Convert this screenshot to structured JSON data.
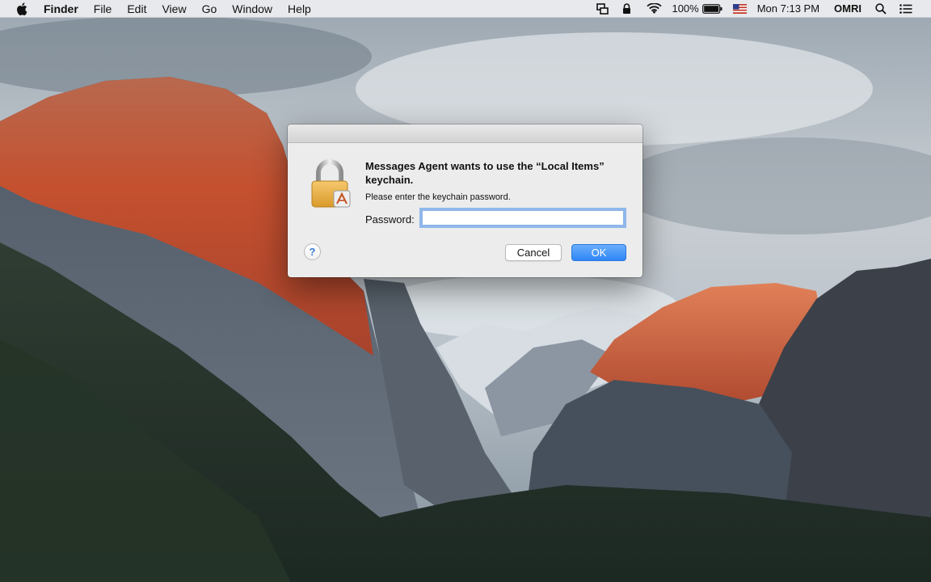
{
  "menubar": {
    "app_name": "Finder",
    "menus": [
      "File",
      "Edit",
      "View",
      "Go",
      "Window",
      "Help"
    ],
    "status": {
      "battery_percent": "100%",
      "clock": "Mon 7:13 PM",
      "user": "OMRI"
    },
    "icons": [
      "apple-logo",
      "screen-mirroring-icon",
      "lock-icon",
      "wifi-icon",
      "battery-icon",
      "us-flag-input-source-icon",
      "spotlight-search-icon",
      "notification-center-icon"
    ]
  },
  "dialog": {
    "heading": "Messages Agent wants to use the “Local Items” keychain.",
    "subtext": "Please enter the keychain password.",
    "password_label": "Password:",
    "password_value": "",
    "help_label": "?",
    "cancel_label": "Cancel",
    "ok_label": "OK",
    "icon": "padlock-keychain-icon"
  },
  "colors": {
    "accent": "#2f86f6",
    "focus_ring": "#5e9ceb"
  }
}
